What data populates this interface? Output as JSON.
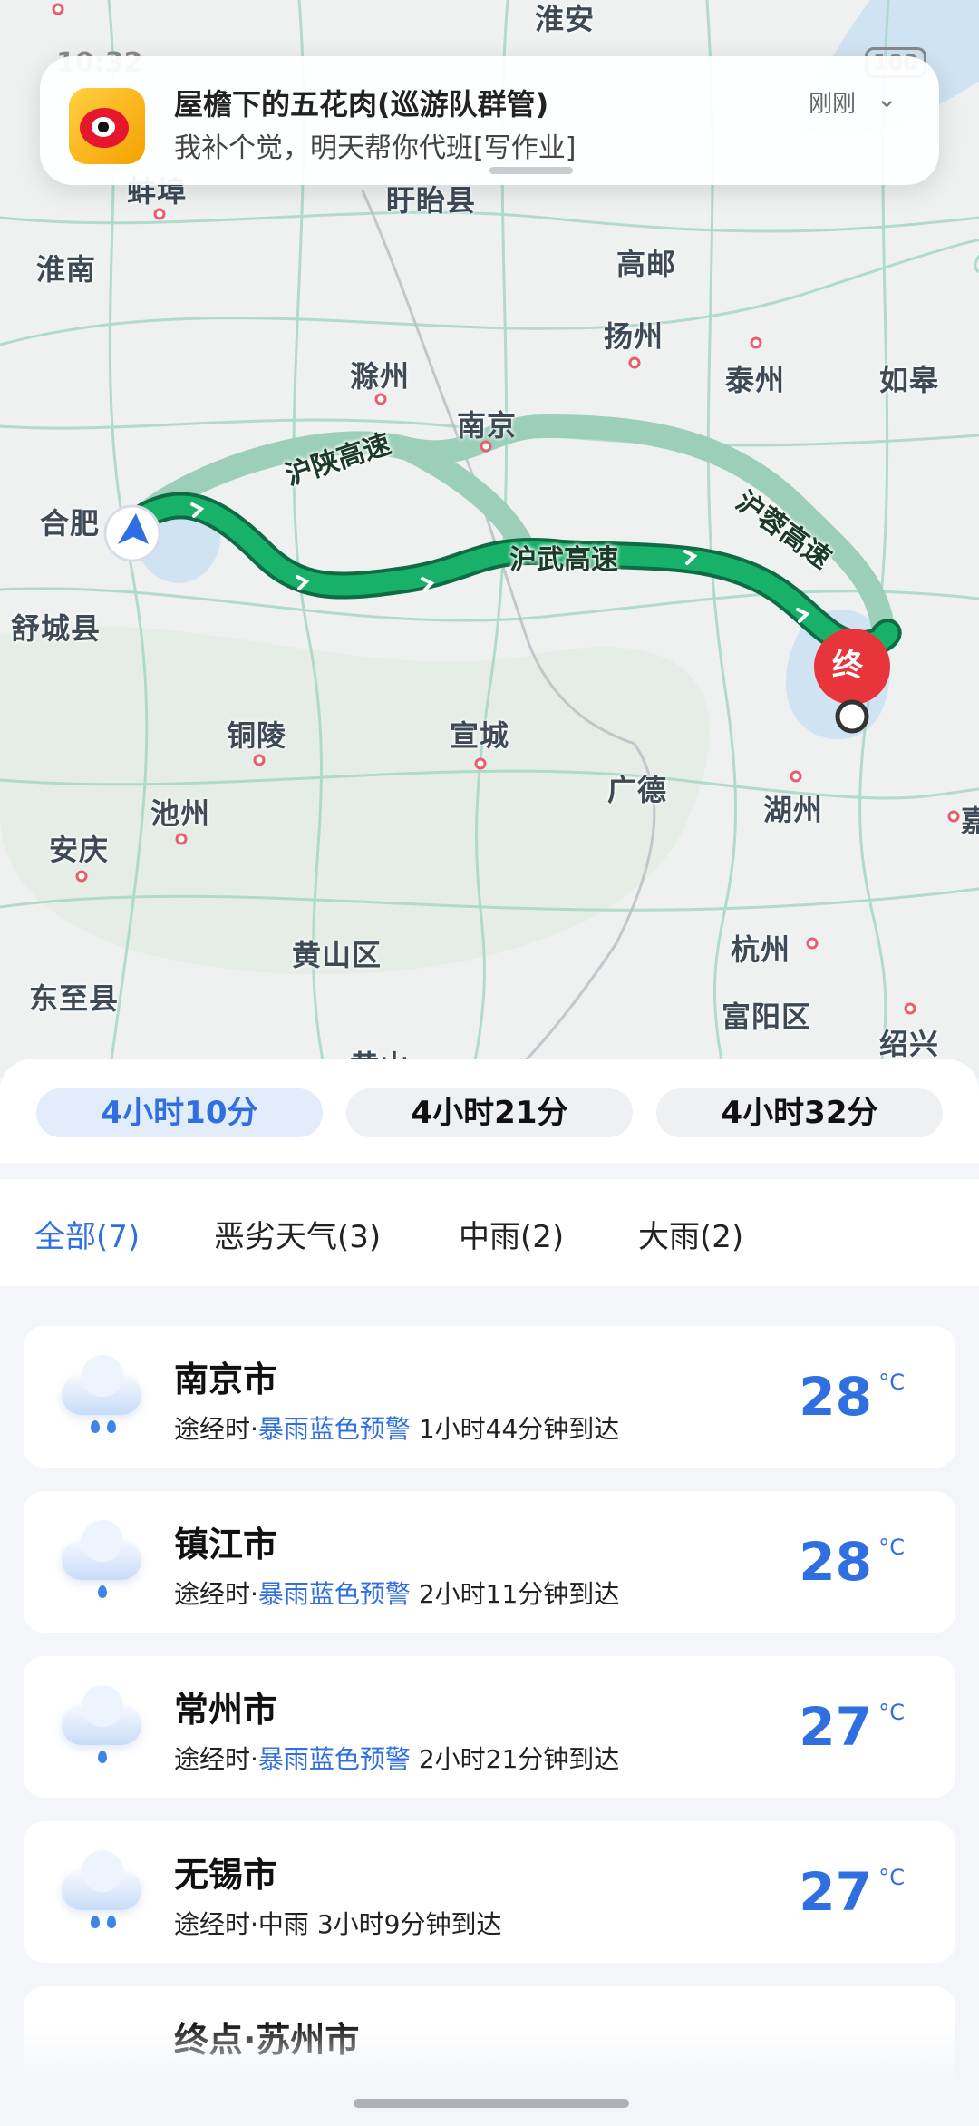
{
  "status_bar": {
    "time": "10:32",
    "battery": "100"
  },
  "notification": {
    "app_icon": "weibo-icon",
    "title": "屋檐下的五花肉(巡游队群管)",
    "message": "我补个觉，明天帮你代班[写作业]",
    "time": "刚刚"
  },
  "map": {
    "cities": [
      "淮安",
      "蚌埠",
      "盱眙县",
      "淮南",
      "高邮",
      "扬州",
      "滁州",
      "泰州",
      "如皋",
      "南京",
      "合肥",
      "舒城县",
      "铜陵",
      "宣城",
      "广德",
      "湖州",
      "池州",
      "安庆",
      "黄山区",
      "杭州",
      "东至县",
      "富阳区",
      "绍兴",
      "嘉",
      "黄山"
    ],
    "roads": [
      "沪陕高速",
      "沪武高速",
      "沪蓉高速"
    ],
    "destination_marker": "终",
    "colors": {
      "route_primary": "#17b16a",
      "route_alt": "#a8d6c3",
      "marker": "#e8353b"
    }
  },
  "route_options": [
    {
      "label": "4小时10分",
      "active": true
    },
    {
      "label": "4小时21分",
      "active": false
    },
    {
      "label": "4小时32分",
      "active": false
    }
  ],
  "filters": [
    {
      "label": "全部(7)",
      "active": true
    },
    {
      "label": "恶劣天气(3)",
      "active": false
    },
    {
      "label": "中雨(2)",
      "active": false
    },
    {
      "label": "大雨(2)",
      "active": false
    }
  ],
  "weather_cards": [
    {
      "city": "南京市",
      "prefix": "途经时·",
      "warning": "暴雨蓝色预警",
      "eta": "1小时44分钟到达",
      "temp": "28",
      "unit": "°C",
      "icon": "rain-cloud-icon"
    },
    {
      "city": "镇江市",
      "prefix": "途经时·",
      "warning": "暴雨蓝色预警",
      "eta": "2小时11分钟到达",
      "temp": "28",
      "unit": "°C",
      "icon": "rain-cloud-icon"
    },
    {
      "city": "常州市",
      "prefix": "途经时·",
      "warning": "暴雨蓝色预警",
      "eta": "2小时21分钟到达",
      "temp": "27",
      "unit": "°C",
      "icon": "rain-cloud-icon"
    },
    {
      "city": "无锡市",
      "prefix": "途经时·",
      "warning": "",
      "condition": "中雨",
      "eta": "3小时9分钟到达",
      "temp": "27",
      "unit": "°C",
      "icon": "rain-cloud-icon"
    },
    {
      "city": "终点·苏州市"
    }
  ]
}
